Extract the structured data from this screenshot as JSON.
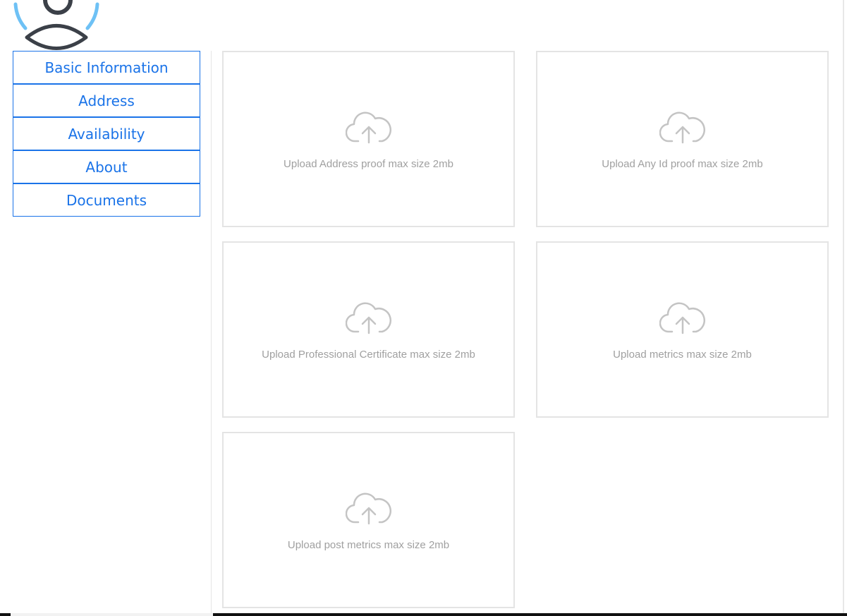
{
  "avatar": {
    "icon": "user-avatar-icon",
    "ring_color": "#6ec1f5",
    "figure_color": "#3b4048"
  },
  "sidebar": {
    "accent_color": "#1a73e8",
    "items": [
      {
        "label": "Basic Information"
      },
      {
        "label": "Address"
      },
      {
        "label": "Availability"
      },
      {
        "label": "About"
      },
      {
        "label": "Documents"
      }
    ]
  },
  "uploads": {
    "icon": "cloud-upload-icon",
    "icon_color": "#c4c4c4",
    "cards": [
      {
        "label": "Upload Address proof max size 2mb"
      },
      {
        "label": "Upload Any Id proof max size 2mb"
      },
      {
        "label": "Upload Professional Certificate max size 2mb"
      },
      {
        "label": "Upload metrics max size 2mb"
      },
      {
        "label": "Upload post metrics max size 2mb"
      }
    ]
  }
}
